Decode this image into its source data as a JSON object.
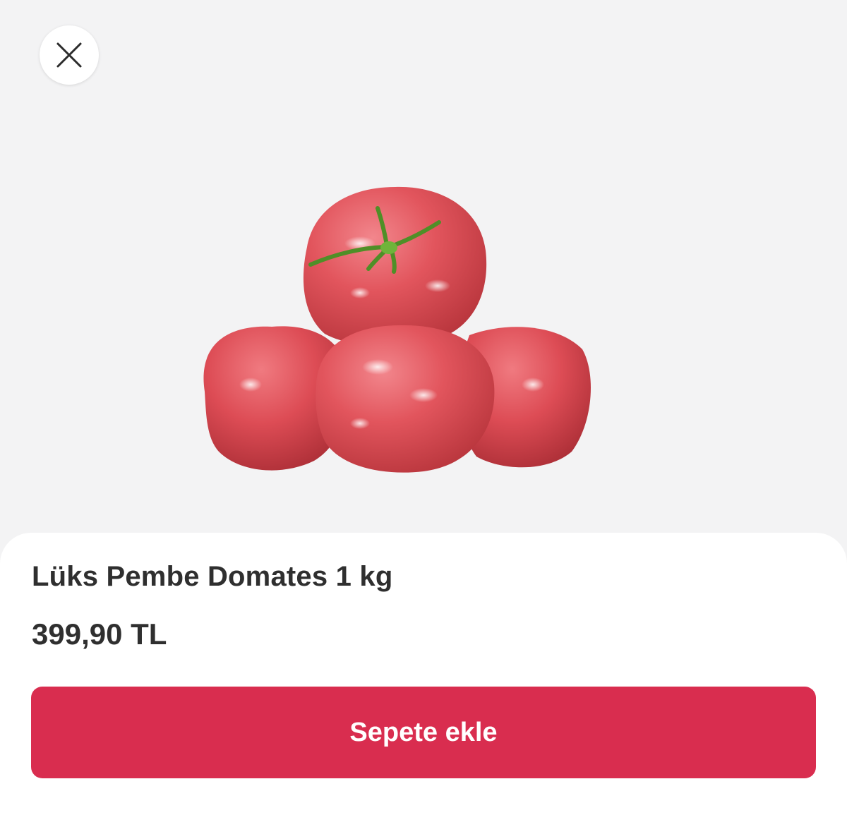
{
  "product": {
    "name": "Lüks Pembe Domates 1 kg",
    "price": "399,90 TL",
    "image_icon": "tomatoes-image"
  },
  "actions": {
    "close_icon": "close-icon",
    "add_to_cart_label": "Sepete ekle"
  },
  "colors": {
    "background": "#f3f3f4",
    "sheet": "#ffffff",
    "text": "#2f2f2f",
    "accent": "#d92d4f",
    "button_text": "#ffffff",
    "tomato": "#e4535c",
    "stem": "#5a9c2e"
  }
}
